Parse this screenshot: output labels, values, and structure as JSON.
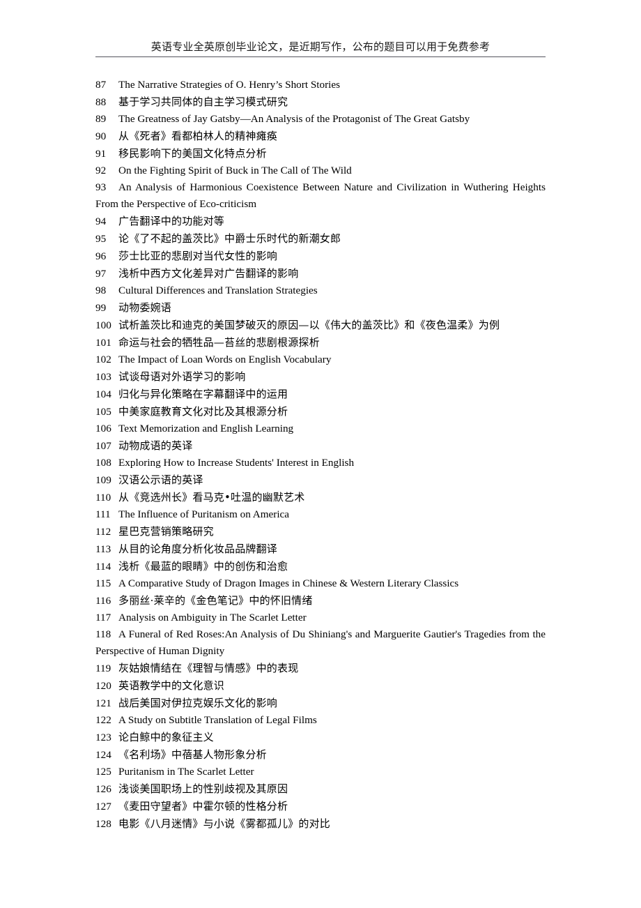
{
  "header": {
    "text": "英语专业全英原创毕业论文，是近期写作，公布的题目可以用于免费参考"
  },
  "list": {
    "items": [
      {
        "num": "87",
        "title": "The Narrative Strategies of O. Henry’s Short Stories",
        "lang": "en",
        "wrap": false
      },
      {
        "num": "88",
        "title": "基于学习共同体的自主学习模式研究",
        "lang": "cjk",
        "wrap": false
      },
      {
        "num": "89",
        "title": "The Greatness of Jay Gatsby—An Analysis of the Protagonist of The Great Gatsby",
        "lang": "en",
        "wrap": false
      },
      {
        "num": "90",
        "title": "从《死者》看都柏林人的精神瘫痪",
        "lang": "cjk",
        "wrap": false
      },
      {
        "num": "91",
        "title": "移民影响下的美国文化特点分析",
        "lang": "cjk",
        "wrap": false
      },
      {
        "num": "92",
        "title": "On the Fighting Spirit of Buck in The Call of The Wild",
        "lang": "en",
        "wrap": false
      },
      {
        "num": "93",
        "title": "An Analysis of Harmonious Coexistence Between Nature and Civilization in Wuthering Heights From the Perspective of Eco-criticism",
        "lang": "en",
        "wrap": true
      },
      {
        "num": "94",
        "title": "广告翻译中的功能对等",
        "lang": "cjk",
        "wrap": false
      },
      {
        "num": "95",
        "title": "论《了不起的盖茨比》中爵士乐时代的新潮女郎",
        "lang": "cjk",
        "wrap": false
      },
      {
        "num": "96",
        "title": "莎士比亚的悲剧对当代女性的影响",
        "lang": "cjk",
        "wrap": false
      },
      {
        "num": "97",
        "title": "浅析中西方文化差异对广告翻译的影响",
        "lang": "cjk",
        "wrap": false
      },
      {
        "num": "98",
        "title": "Cultural Differences and Translation Strategies",
        "lang": "en",
        "wrap": false
      },
      {
        "num": "99",
        "title": "动物委婉语",
        "lang": "cjk",
        "wrap": false
      },
      {
        "num": "100",
        "title": "试析盖茨比和迪克的美国梦破灭的原因—以《伟大的盖茨比》和《夜色温柔》为例",
        "lang": "cjk",
        "wrap": false
      },
      {
        "num": "101",
        "title": "命运与社会的牺牲品—苔丝的悲剧根源探析",
        "lang": "cjk",
        "wrap": false
      },
      {
        "num": "102",
        "title": "The Impact of Loan Words on English Vocabulary",
        "lang": "en",
        "wrap": false
      },
      {
        "num": "103",
        "title": "试谈母语对外语学习的影响",
        "lang": "cjk",
        "wrap": false
      },
      {
        "num": "104",
        "title": "归化与异化策略在字幕翻译中的运用",
        "lang": "cjk",
        "wrap": false
      },
      {
        "num": "105",
        "title": "中美家庭教育文化对比及其根源分析",
        "lang": "cjk",
        "wrap": false
      },
      {
        "num": "106",
        "title": "Text Memorization and English Learning",
        "lang": "en",
        "wrap": false
      },
      {
        "num": "107",
        "title": "动物成语的英译",
        "lang": "cjk",
        "wrap": false
      },
      {
        "num": "108",
        "title": "Exploring How to Increase Students' Interest in English",
        "lang": "en",
        "wrap": false
      },
      {
        "num": "109",
        "title": "汉语公示语的英译",
        "lang": "cjk",
        "wrap": false
      },
      {
        "num": "110",
        "title": "从《竞选州长》看马克•吐温的幽默艺术",
        "lang": "cjk",
        "wrap": false
      },
      {
        "num": "111",
        "title": "The Influence of Puritanism on America",
        "lang": "en",
        "wrap": false
      },
      {
        "num": "112",
        "title": "星巴克营销策略研究",
        "lang": "cjk",
        "wrap": false
      },
      {
        "num": "113",
        "title": "从目的论角度分析化妆品品牌翻译",
        "lang": "cjk",
        "wrap": false
      },
      {
        "num": "114",
        "title": "浅析《最蓝的眼睛》中的创伤和治愈",
        "lang": "cjk",
        "wrap": false
      },
      {
        "num": "115",
        "title": "A Comparative Study of Dragon Images in Chinese & Western Literary Classics",
        "lang": "en",
        "wrap": false
      },
      {
        "num": "116",
        "title": "多丽丝·莱辛的《金色笔记》中的怀旧情绪",
        "lang": "cjk",
        "wrap": false
      },
      {
        "num": "117",
        "title": "Analysis on Ambiguity in The Scarlet Letter",
        "lang": "en",
        "wrap": false
      },
      {
        "num": "118",
        "title": "A Funeral of Red Roses:An Analysis of Du Shiniang's and Marguerite Gautier's Tragedies from the Perspective of Human Dignity",
        "lang": "en",
        "wrap": true
      },
      {
        "num": "119",
        "title": "灰姑娘情结在《理智与情感》中的表现",
        "lang": "cjk",
        "wrap": false
      },
      {
        "num": "120",
        "title": "英语教学中的文化意识",
        "lang": "cjk",
        "wrap": false
      },
      {
        "num": "121",
        "title": "战后美国对伊拉克娱乐文化的影响",
        "lang": "cjk",
        "wrap": false
      },
      {
        "num": "122",
        "title": "A Study on Subtitle Translation of Legal Films",
        "lang": "en",
        "wrap": false
      },
      {
        "num": "123",
        "title": "论白鲸中的象征主义",
        "lang": "cjk",
        "wrap": false
      },
      {
        "num": "124",
        "title": "《名利场》中蓓基人物形象分析",
        "lang": "cjk",
        "wrap": false
      },
      {
        "num": "125",
        "title": "Puritanism in The Scarlet Letter",
        "lang": "en",
        "wrap": false
      },
      {
        "num": "126",
        "title": "浅谈美国职场上的性别歧视及其原因",
        "lang": "cjk",
        "wrap": false
      },
      {
        "num": "127",
        "title": "《麦田守望者》中霍尔顿的性格分析",
        "lang": "cjk",
        "wrap": false
      },
      {
        "num": "128",
        "title": "电影《八月迷情》与小说《雾都孤儿》的对比",
        "lang": "cjk",
        "wrap": false
      }
    ]
  }
}
